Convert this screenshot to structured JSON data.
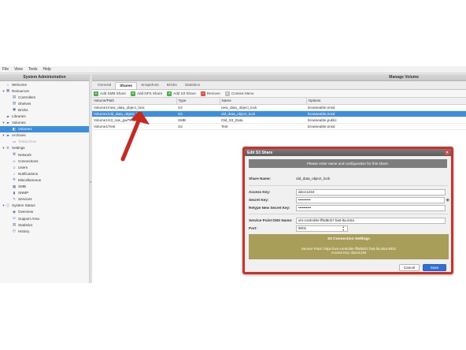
{
  "menu": [
    "File",
    "View",
    "Tools",
    "Help"
  ],
  "sidebar": {
    "title": "System Administration",
    "items": [
      {
        "label": "Welcome",
        "icon": "home-icon",
        "level": 0,
        "twisty": ""
      },
      {
        "label": "Resources",
        "icon": "grid-icon",
        "level": 0,
        "twisty": "▼"
      },
      {
        "label": "Controllers",
        "icon": "server-icon",
        "level": 1,
        "twisty": ""
      },
      {
        "label": "Shelves",
        "icon": "shelf-icon",
        "level": 1,
        "twisty": ""
      },
      {
        "label": "Bricks",
        "icon": "brick-icon",
        "level": 1,
        "twisty": ""
      },
      {
        "label": "Libraries",
        "icon": "folder-icon",
        "level": 0,
        "twisty": ""
      },
      {
        "label": "Volumes",
        "icon": "folder-icon",
        "level": 0,
        "twisty": "▼"
      },
      {
        "label": "Volume1",
        "icon": "volume-icon",
        "level": 1,
        "twisty": "",
        "selected": true
      },
      {
        "label": "Archives",
        "icon": "folder-icon",
        "level": 0,
        "twisty": "▼"
      },
      {
        "label": "Testarchive",
        "icon": "archive-icon",
        "level": 1,
        "twisty": "",
        "dim": true
      },
      {
        "label": "Settings",
        "icon": "gear-icon",
        "level": 0,
        "twisty": "▼"
      },
      {
        "label": "Network",
        "icon": "network-icon",
        "level": 1,
        "twisty": ""
      },
      {
        "label": "Connections",
        "icon": "link-icon",
        "level": 1,
        "twisty": ""
      },
      {
        "label": "Users",
        "icon": "user-icon",
        "level": 1,
        "twisty": ""
      },
      {
        "label": "Notifications",
        "icon": "bell-icon",
        "level": 1,
        "twisty": ""
      },
      {
        "label": "Miscellaneous",
        "icon": "gear-icon",
        "level": 1,
        "twisty": ""
      },
      {
        "label": "SMB",
        "icon": "share-icon",
        "level": 1,
        "twisty": ""
      },
      {
        "label": "SNMP",
        "icon": "chart-icon",
        "level": 1,
        "twisty": ""
      },
      {
        "label": "Services",
        "icon": "wrench-icon",
        "level": 1,
        "twisty": ""
      },
      {
        "label": "System Status",
        "icon": "info-icon",
        "level": 0,
        "twisty": "▼"
      },
      {
        "label": "Overview",
        "icon": "eye-icon",
        "level": 1,
        "twisty": ""
      },
      {
        "label": "Support Area",
        "icon": "phone-icon",
        "level": 1,
        "twisty": ""
      },
      {
        "label": "Statistics",
        "icon": "stats-icon",
        "level": 1,
        "twisty": ""
      },
      {
        "label": "History",
        "icon": "clock-icon",
        "level": 1,
        "twisty": ""
      }
    ]
  },
  "main": {
    "title": "Manage Volume",
    "tabs": [
      {
        "label": "General",
        "active": false
      },
      {
        "label": "Shares",
        "active": true
      },
      {
        "label": "Snapshots",
        "active": false
      },
      {
        "label": "Bricks",
        "active": false
      },
      {
        "label": "Statistics",
        "active": false
      }
    ],
    "toolbar": [
      {
        "label": "Add SMB Share",
        "icon": "plus-icon",
        "color": "green"
      },
      {
        "label": "Add NFS Share",
        "icon": "plus-icon",
        "color": "green"
      },
      {
        "label": "Add S3 Share",
        "icon": "plus-icon",
        "color": "green"
      },
      {
        "label": "Remove",
        "icon": "remove-icon",
        "color": "red"
      },
      {
        "label": "Context Menu",
        "icon": "menu-icon",
        "color": "gray"
      }
    ],
    "columns": [
      "Volume/Path",
      "Type",
      "Name",
      "Options"
    ],
    "rows": [
      {
        "cells": [
          "Volume1/new_data_object_lock",
          "S3",
          "new_data_object_lock",
          "browseable,snsd"
        ],
        "selected": false
      },
      {
        "cells": [
          "Volume1/old_data_object_lock",
          "S3",
          "old_data_object_lock",
          "browseable,snsd"
        ],
        "selected": true
      },
      {
        "cells": [
          "Volume1/s3_nas_gw/Test",
          "SMB",
          "Old_S3_Data",
          "browseable,public"
        ],
        "selected": false
      },
      {
        "cells": [
          "Volume1/Test",
          "S3",
          "Test",
          "browseable,snsd"
        ],
        "selected": false
      }
    ]
  },
  "dialog": {
    "title": "Edit S3 Share",
    "banner": "Please enter name and configuration for this share.",
    "share_name_label": "Share Name:",
    "share_name_value": "old_data_object_lock",
    "access_key_label": "Access Key:",
    "access_key_value": "abce1234",
    "secret_key_label": "Secret Key:",
    "secret_key_value": "••••••••••",
    "retype_label": "Retype New Secret Key:",
    "retype_value": "••••••••••",
    "dns_label": "Service Point DNS Name:",
    "dns_value": "vm-controller-ff5d8cb7.fast-lta.intra",
    "port_label": "Port:",
    "port_value": "9001",
    "s3_box": {
      "heading": "S3 Connection Settings",
      "service_point": "Service Point: https://vm-controller-ff5d8cb7.fast-lta.intra:9001",
      "access_key": "Access Key: abce1234"
    },
    "cancel_label": "Cancel",
    "save_label": "Save",
    "close_glyph": "×"
  },
  "colors": {
    "selection": "#3d8fdc",
    "dialog_highlight": "#d0302a",
    "annotation_arrow": "#c8281f",
    "s3_box": "#a89d59",
    "save_button": "#2f6fd6"
  }
}
